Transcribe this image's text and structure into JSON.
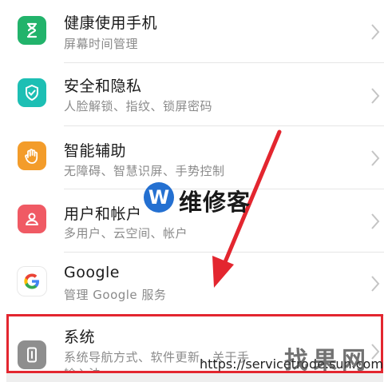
{
  "settings": {
    "items": [
      {
        "title": "健康使用手机",
        "subtitle": "屏幕时间管理",
        "icon": "hourglass-icon",
        "color": "#22b36b"
      },
      {
        "title": "安全和隐私",
        "subtitle": "人脸解锁、指纹、锁屏密码",
        "icon": "shield-check-icon",
        "color": "#1dbfb4"
      },
      {
        "title": "智能辅助",
        "subtitle": "无障碍、智慧识屏、手势控制",
        "icon": "hand-icon",
        "color": "#f39c2a"
      },
      {
        "title": "用户和帐户",
        "subtitle": "多用户、云空间、帐户",
        "icon": "user-icon",
        "color": "#f05a64"
      },
      {
        "title": "Google",
        "subtitle": "管理 Google 服务",
        "icon": "google-icon",
        "color": "#ffffff"
      },
      {
        "title": "系统",
        "subtitle": "系统导航方式、软件更新、关于手",
        "subtitle2": "输入法",
        "icon": "phone-icon",
        "color": "#8e8e8e"
      }
    ]
  },
  "annotation": {
    "arrow_color": "#e3262f",
    "box_color": "#e3262f"
  },
  "watermark": {
    "logo_letter": "W",
    "brand": "维修客",
    "url": "https://servicetrode.sun.com",
    "zh": "找果网"
  }
}
